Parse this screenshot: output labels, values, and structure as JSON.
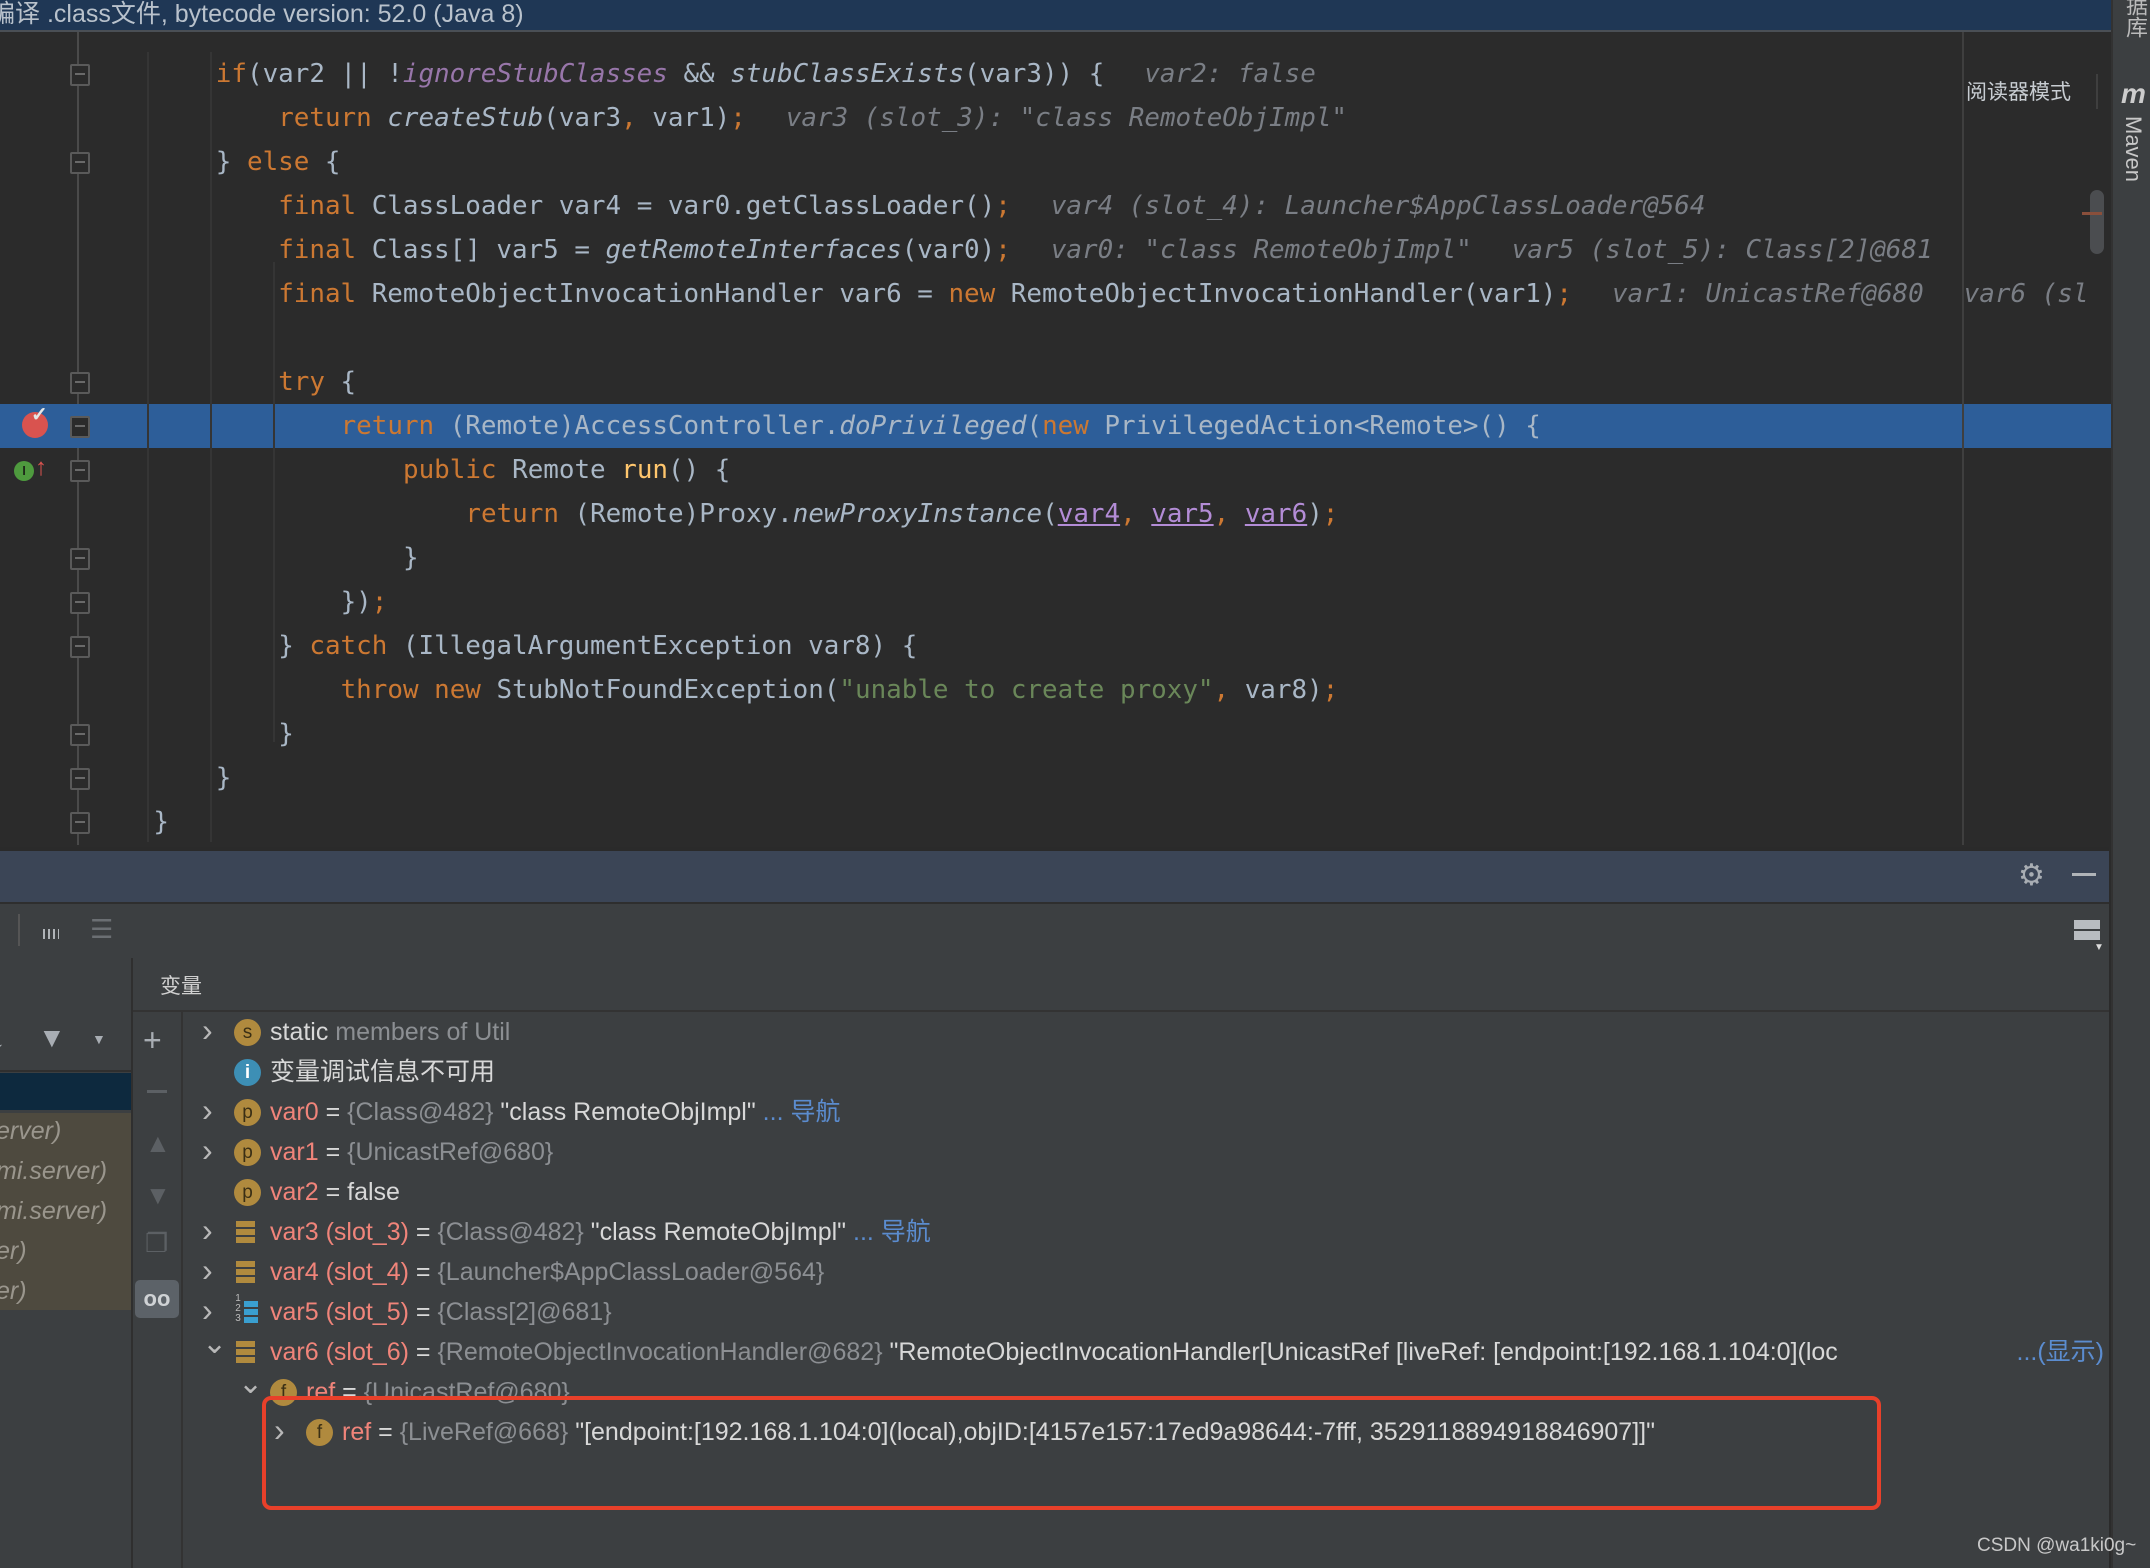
{
  "titlebar": {
    "text": "编译 .class文件, bytecode version: 52.0 (Java 8)"
  },
  "editor": {
    "reader_mode": "阅读器模式",
    "highlight_line": 8,
    "lines": [
      {
        "indent": 8,
        "tokens": [
          [
            "kw",
            "if"
          ],
          [
            "",
            "(var2 || !"
          ],
          [
            "field",
            "ignoreStubClasses"
          ],
          [
            "",
            " && "
          ],
          [
            "it",
            "stubClassExists"
          ],
          [
            "",
            "(var3)) {"
          ],
          [
            "hint",
            "var2: false"
          ]
        ]
      },
      {
        "indent": 12,
        "tokens": [
          [
            "kw",
            "return"
          ],
          [
            "",
            " "
          ],
          [
            "it",
            "createStub"
          ],
          [
            "",
            "(var3"
          ],
          [
            "kw",
            ","
          ],
          [
            "",
            " var1)"
          ],
          [
            "kw",
            ";"
          ],
          [
            "hint",
            "var3 (slot_3): \"class RemoteObjImpl\""
          ]
        ]
      },
      {
        "indent": 8,
        "tokens": [
          [
            "",
            "} "
          ],
          [
            "kw",
            "else"
          ],
          [
            "",
            " {"
          ]
        ]
      },
      {
        "indent": 12,
        "tokens": [
          [
            "kw",
            "final"
          ],
          [
            "",
            " ClassLoader var4 = var0.getClassLoader()"
          ],
          [
            "kw",
            ";"
          ],
          [
            "hint",
            "var4 (slot_4): Launcher$AppClassLoader@564"
          ]
        ]
      },
      {
        "indent": 12,
        "tokens": [
          [
            "kw",
            "final"
          ],
          [
            "",
            " Class[] var5 = "
          ],
          [
            "it",
            "getRemoteInterfaces"
          ],
          [
            "",
            "(var0)"
          ],
          [
            "kw",
            ";"
          ],
          [
            "hint",
            "var0: \"class RemoteObjImpl\""
          ],
          [
            "hint",
            "var5 (slot_5): Class[2]@681"
          ]
        ]
      },
      {
        "indent": 12,
        "tokens": [
          [
            "kw",
            "final"
          ],
          [
            "",
            " RemoteObjectInvocationHandler var6 = "
          ],
          [
            "kw",
            "new"
          ],
          [
            "",
            " RemoteObjectInvocationHandler(var1)"
          ],
          [
            "kw",
            ";"
          ],
          [
            "hint",
            "var1: UnicastRef@680"
          ],
          [
            "hint",
            "var6 (sl"
          ]
        ]
      },
      {
        "indent": 0,
        "tokens": []
      },
      {
        "indent": 12,
        "tokens": [
          [
            "kw",
            "try"
          ],
          [
            "",
            " {"
          ]
        ]
      },
      {
        "indent": 16,
        "tokens": [
          [
            "kw",
            "return"
          ],
          [
            "",
            " (Remote)AccessController."
          ],
          [
            "it",
            "doPrivileged"
          ],
          [
            "",
            "("
          ],
          [
            "kw",
            "new"
          ],
          [
            "",
            " PrivilegedAction<Remote>() {"
          ]
        ]
      },
      {
        "indent": 20,
        "tokens": [
          [
            "kw",
            "public"
          ],
          [
            "",
            " Remote "
          ],
          [
            "meth",
            "run"
          ],
          [
            "",
            "() {"
          ]
        ]
      },
      {
        "indent": 24,
        "tokens": [
          [
            "kw",
            "return"
          ],
          [
            "",
            " (Remote)Proxy."
          ],
          [
            "it",
            "newProxyInstance"
          ],
          [
            "",
            "("
          ],
          [
            "ul",
            "var4"
          ],
          [
            "kw",
            ","
          ],
          [
            "",
            " "
          ],
          [
            "ul",
            "var5"
          ],
          [
            "kw",
            ","
          ],
          [
            "",
            " "
          ],
          [
            "ul",
            "var6"
          ],
          [
            "",
            ")"
          ],
          [
            "kw",
            ";"
          ]
        ]
      },
      {
        "indent": 20,
        "tokens": [
          [
            "",
            "}"
          ]
        ]
      },
      {
        "indent": 16,
        "tokens": [
          [
            "",
            "})"
          ],
          [
            "kw",
            ";"
          ]
        ]
      },
      {
        "indent": 12,
        "tokens": [
          [
            "",
            "} "
          ],
          [
            "kw",
            "catch"
          ],
          [
            "",
            " (IllegalArgumentException var8) {"
          ]
        ]
      },
      {
        "indent": 16,
        "tokens": [
          [
            "kw",
            "throw"
          ],
          [
            "",
            " "
          ],
          [
            "kw",
            "new"
          ],
          [
            "",
            " StubNotFoundException("
          ],
          [
            "str",
            "\"unable to create proxy\""
          ],
          [
            "kw",
            ","
          ],
          [
            "",
            " var8)"
          ],
          [
            "kw",
            ";"
          ]
        ]
      },
      {
        "indent": 12,
        "tokens": [
          [
            "",
            "}"
          ]
        ]
      },
      {
        "indent": 8,
        "tokens": [
          [
            "",
            "}"
          ]
        ]
      },
      {
        "indent": 4,
        "tokens": [
          [
            "",
            "}"
          ]
        ]
      }
    ],
    "fold_lines": [
      0,
      2,
      7,
      8,
      9,
      11,
      12,
      13,
      15,
      16,
      17
    ]
  },
  "right_strip": {
    "database_label": "据库",
    "maven_icon": "m",
    "maven_label": "Maven"
  },
  "debugger": {
    "header_icons": [
      "gear-icon",
      "minimize-icon"
    ],
    "toolbar_icons": [
      "evaluate-calculator-icon",
      "threads-icon",
      "layout-icon"
    ],
    "variables_title": "变量",
    "frames": [
      "erver)",
      "mi.server)",
      "mi.server)",
      "er)",
      "er)"
    ],
    "variables": [
      {
        "level": 0,
        "arrow": "right",
        "icon": "s",
        "parts": [
          [
            "vw",
            "static"
          ],
          [
            "vt",
            " members of Util"
          ]
        ]
      },
      {
        "level": 0,
        "arrow": "",
        "icon": "info",
        "parts": [
          [
            "vw",
            "变量调试信息不可用"
          ]
        ]
      },
      {
        "level": 0,
        "arrow": "right",
        "icon": "p",
        "parts": [
          [
            "vn",
            "var0"
          ],
          [
            "vw",
            " = "
          ],
          [
            "vt",
            "{Class@482}"
          ],
          [
            "vw",
            " \"class RemoteObjImpl\""
          ],
          [
            "vl",
            " ... 导航"
          ]
        ]
      },
      {
        "level": 0,
        "arrow": "right",
        "icon": "p",
        "parts": [
          [
            "vn",
            "var1"
          ],
          [
            "vw",
            " = "
          ],
          [
            "vt",
            "{UnicastRef@680}"
          ]
        ]
      },
      {
        "level": 0,
        "arrow": "",
        "icon": "p",
        "parts": [
          [
            "vn",
            "var2"
          ],
          [
            "vw",
            " = false"
          ]
        ]
      },
      {
        "level": 0,
        "arrow": "right",
        "icon": "local",
        "parts": [
          [
            "vn",
            "var3 (slot_3)"
          ],
          [
            "vw",
            " = "
          ],
          [
            "vt",
            "{Class@482}"
          ],
          [
            "vw",
            " \"class RemoteObjImpl\""
          ],
          [
            "vl",
            " ... 导航"
          ]
        ]
      },
      {
        "level": 0,
        "arrow": "right",
        "icon": "local",
        "parts": [
          [
            "vn",
            "var4 (slot_4)"
          ],
          [
            "vw",
            " = "
          ],
          [
            "vt",
            "{Launcher$AppClassLoader@564}"
          ]
        ]
      },
      {
        "level": 0,
        "arrow": "right",
        "icon": "array",
        "parts": [
          [
            "vn",
            "var5 (slot_5)"
          ],
          [
            "vw",
            " = "
          ],
          [
            "vt",
            "{Class[2]@681}"
          ]
        ]
      },
      {
        "level": 0,
        "arrow": "down",
        "icon": "local",
        "parts": [
          [
            "vn",
            "var6 (slot_6)"
          ],
          [
            "vw",
            " = "
          ],
          [
            "vt",
            "{RemoteObjectInvocationHandler@682}"
          ],
          [
            "vw",
            " \"RemoteObjectInvocationHandler[UnicastRef [liveRef: [endpoint:[192.168.1.104:0](loc"
          ]
        ],
        "link": "...(显示)"
      },
      {
        "level": 1,
        "arrow": "down",
        "icon": "f",
        "parts": [
          [
            "vn",
            "ref"
          ],
          [
            "vw",
            " = "
          ],
          [
            "vt",
            "{UnicastRef@680}"
          ]
        ]
      },
      {
        "level": 2,
        "arrow": "right",
        "icon": "f",
        "parts": [
          [
            "vn",
            "ref"
          ],
          [
            "vw",
            " = "
          ],
          [
            "vt",
            "{LiveRef@668}"
          ],
          [
            "vw",
            " \"[endpoint:[192.168.1.104:0](local),objID:[4157e157:17ed9a98644:-7fff, 3529118894918846907]]\""
          ]
        ]
      }
    ]
  },
  "annotation": {
    "color": "#e8402a"
  },
  "watermark": "CSDN @wa1ki0g~"
}
